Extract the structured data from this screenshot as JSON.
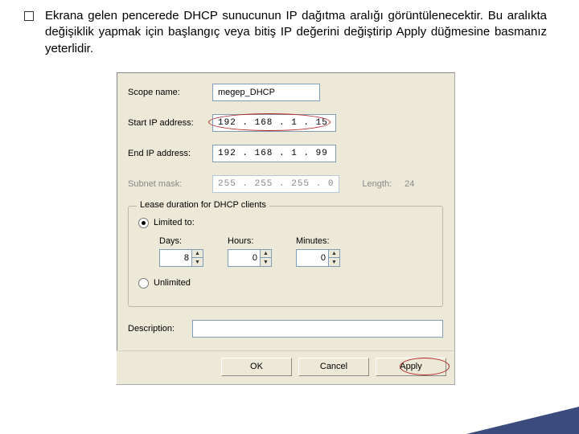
{
  "intro": {
    "text": "Ekrana gelen pencerede DHCP sunucunun IP dağıtma aralığı görüntülenecektir. Bu aralıkta değişiklik yapmak için başlangıç veya bitiş IP değerini değiştirip Apply düğmesine basmanız yeterlidir."
  },
  "dialog": {
    "scope_name_label": "Scope name:",
    "scope_name_value": "megep_DHCP",
    "start_ip_label": "Start IP address:",
    "start_ip_value": "192 . 168 .  1  .  15",
    "end_ip_label": "End IP address:",
    "end_ip_value": "192 . 168 .  1  .  99",
    "subnet_label": "Subnet mask:",
    "subnet_value": "255 . 255 . 255 .  0",
    "length_label": "Length:",
    "length_value": "24",
    "lease_legend": "Lease duration for DHCP clients",
    "limited_label": "Limited to:",
    "days_label": "Days:",
    "days_value": "8",
    "hours_label": "Hours:",
    "hours_value": "0",
    "minutes_label": "Minutes:",
    "minutes_value": "0",
    "unlimited_label": "Unlimited",
    "description_label": "Description:",
    "description_value": "",
    "buttons": {
      "ok": "OK",
      "cancel": "Cancel",
      "apply": "Apply"
    }
  }
}
